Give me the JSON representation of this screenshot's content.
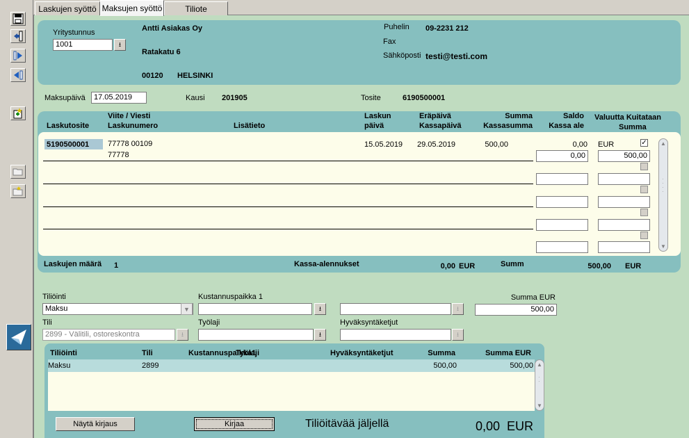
{
  "tabs": [
    "Laskujen syöttö",
    "Maksujen syöttö",
    "Tiliote"
  ],
  "toolbar": {
    "icons": [
      "save-icon",
      "exit-icon",
      "next-icon",
      "prev-icon",
      "new-icon",
      "open-folder-icon",
      "folder-icon"
    ]
  },
  "customer": {
    "company_id_label": "Yritystunnus",
    "company_id": "1001",
    "name": "Antti Asiakas Oy",
    "street": "Ratakatu 6",
    "postal_code": "00120",
    "city": "HELSINKI",
    "phone_label": "Puhelin",
    "phone": "09-2231 212",
    "fax_label": "Fax",
    "email_label": "Sähköposti",
    "email": "testi@testi.com"
  },
  "payment": {
    "date_label": "Maksupäivä",
    "date": "17.05.2019",
    "period_label": "Kausi",
    "period": "201905",
    "voucher_label": "Tosite",
    "voucher": "6190500001"
  },
  "invoices": {
    "headers": {
      "voucher": "Laskutosite",
      "ref": "Viite / Viesti",
      "invoice_no": "Laskunumero",
      "extra": "Lisätieto",
      "inv_date1": "Laskun",
      "inv_date2": "päivä",
      "due1": "Eräpäivä",
      "due2": "Kassapäivä",
      "sum1": "Summa",
      "sum2": "Kassasumma",
      "bal1": "Saldo",
      "bal2": "Kassa ale",
      "cur1": "Valuutta Kuitataan",
      "cur2": "Summa"
    },
    "row": {
      "voucher": "5190500001",
      "ref": "77778 00109",
      "invoice_no": "77778",
      "inv_date": "15.05.2019",
      "due_date": "29.05.2019",
      "sum": "500,00",
      "balance": "0,00",
      "currency": "EUR",
      "cash_discount": "0,00",
      "settle_sum": "500,00"
    },
    "footer": {
      "count_label": "Laskujen määrä",
      "count": "1",
      "cash_discounts_label": "Kassa-alennukset",
      "cash_discounts": "0,00",
      "cash_discounts_cur": "EUR",
      "sum_label": "Summ",
      "sum": "500,00",
      "sum_cur": "EUR"
    }
  },
  "posting": {
    "type_label": "Tiliöinti",
    "type_value": "Maksu",
    "cost_center_label": "Kustannuspaikka 1",
    "sum_label": "Summa EUR",
    "sum_value": "500,00",
    "account_label": "Tili",
    "account_value": "2899 - Välitili, ostoreskontra",
    "work_type_label": "Työlaji",
    "approvers_label": "Hyväksyntäketjut"
  },
  "postings_table": {
    "headers": {
      "type": "Tiliöinti",
      "account": "Tili",
      "cost_center": "Kustannuspaikka1",
      "work_type": "Työlaji",
      "approvers": "Hyväksyntäketjut",
      "sum": "Summa",
      "sum_eur": "Summa EUR"
    },
    "rows": [
      {
        "type": "Maksu",
        "account": "2899",
        "sum": "500,00",
        "sum_eur": "500,00"
      }
    ]
  },
  "bottom": {
    "show_posting_button": "Näytä kirjaus",
    "post_button": "Kirjaa",
    "remaining_label": "Tiliöitävää jäljellä",
    "remaining_value": "0,00",
    "remaining_cur": "EUR"
  }
}
